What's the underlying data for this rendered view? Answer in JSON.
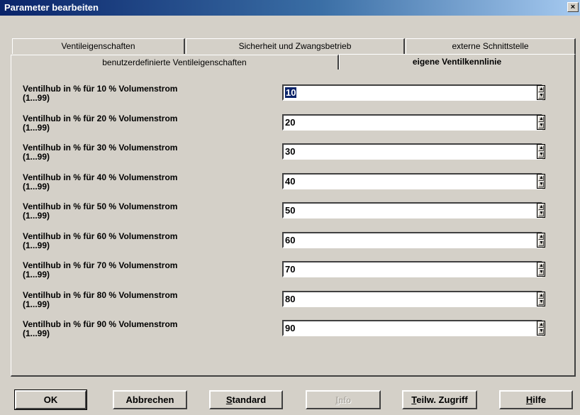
{
  "window": {
    "title": "Parameter bearbeiten",
    "close_label": "×"
  },
  "tabs_row1": [
    "Ventileigenschaften",
    "Sicherheit und Zwangsbetrieb",
    "externe Schnittstelle"
  ],
  "tabs_row2": [
    "benutzerdefinierte Ventileigenschaften",
    "eigene Ventilkennlinie"
  ],
  "active_tab": "eigene Ventilkennlinie",
  "params": [
    {
      "label": "Ventilhub in % für 10 %  Volumenstrom",
      "range": "(1...99)",
      "value": "10"
    },
    {
      "label": "Ventilhub in % für 20 %  Volumenstrom",
      "range": "(1...99)",
      "value": "20"
    },
    {
      "label": "Ventilhub in % für 30 %  Volumenstrom",
      "range": "(1...99)",
      "value": "30"
    },
    {
      "label": "Ventilhub in % für 40 %  Volumenstrom",
      "range": "(1...99)",
      "value": "40"
    },
    {
      "label": "Ventilhub in % für 50 %  Volumenstrom",
      "range": "(1...99)",
      "value": "50"
    },
    {
      "label": "Ventilhub in % für 60 %  Volumenstrom",
      "range": "(1...99)",
      "value": "60"
    },
    {
      "label": "Ventilhub in % für 70 %  Volumenstrom",
      "range": "(1...99)",
      "value": "70"
    },
    {
      "label": "Ventilhub in % für 80 %  Volumenstrom",
      "range": "(1...99)",
      "value": "80"
    },
    {
      "label": "Ventilhub in % für 90 %  Volumenstrom",
      "range": "(1...99)",
      "value": "90"
    }
  ],
  "buttons": {
    "ok": "OK",
    "cancel": "Abbrechen",
    "standard_u": "S",
    "standard_rest": "tandard",
    "info_u": "I",
    "info_rest": "nfo",
    "partial_u": "T",
    "partial_rest": "eilw. Zugriff",
    "help_u": "H",
    "help_rest": "ilfe"
  },
  "colors": {
    "title_gradient_start": "#0a246a",
    "title_gradient_end": "#a6caf0",
    "face": "#d4d0c8"
  }
}
